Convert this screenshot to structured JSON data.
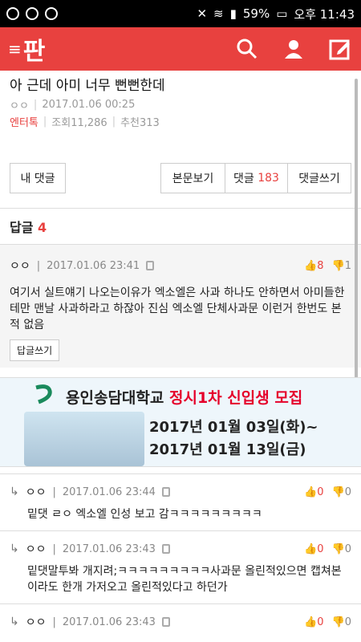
{
  "status": {
    "battery": "59%",
    "time_label": "오후 11:43"
  },
  "app": {
    "logo_text": "판",
    "accent": "#e8413f"
  },
  "post": {
    "title": "아 근데 아미 너무 뻔뻔한데",
    "author": "ㅇㅇ",
    "date": "2017.01.06 00:25",
    "category": "엔터톡",
    "views": "조회11,286",
    "recommend": "추천313"
  },
  "tabs": {
    "my_comments": "내 댓글",
    "view_post": "본문보기",
    "comments_label": "댓글",
    "comments_count": "183",
    "write_comment": "댓글쓰기"
  },
  "replies": {
    "label": "답글",
    "count": "4"
  },
  "comments": [
    {
      "author": "ㅇㅇ",
      "date": "2017.01.06 23:41",
      "likes": "8",
      "dislikes": "1",
      "body": "여기서 실트얘기 나오는이유가 엑소엘은 사과 하나도 안하면서 아미들한테만 맨날 사과하라고 하잖아 진심 엑소엘 단체사과문 이런거 한번도 본적 없음",
      "reply_button": "답글쓰기"
    }
  ],
  "ad": {
    "school": "용인송담대학교",
    "headline": "정시1차 신입생 모집",
    "line1": "2017년 01월 03일(화)~",
    "line2": "2017년 01월 13일(금)"
  },
  "subcomments": [
    {
      "author": "ㅇㅇ",
      "date": "2017.01.06 23:44",
      "likes": "0",
      "dislikes": "0",
      "body": "밑댓 ㄹㅇ 엑소엘 인성 보고 감ㅋㅋㅋㅋㅋㅋㅋㅋㅋ"
    },
    {
      "author": "ㅇㅇ",
      "date": "2017.01.06 23:43",
      "likes": "0",
      "dislikes": "0",
      "body": "밑댓말투봐 개지려;ㅋㅋㅋㅋㅋㅋㅋㅋㅋ사과문 올린적있으면 캡쳐본이라도 한개 가저오고 올린적있다고 하던가"
    },
    {
      "author": "ㅇㅇ",
      "date": "2017.01.06 23:43",
      "likes": "0",
      "dislikes": "0",
      "body": ""
    }
  ]
}
